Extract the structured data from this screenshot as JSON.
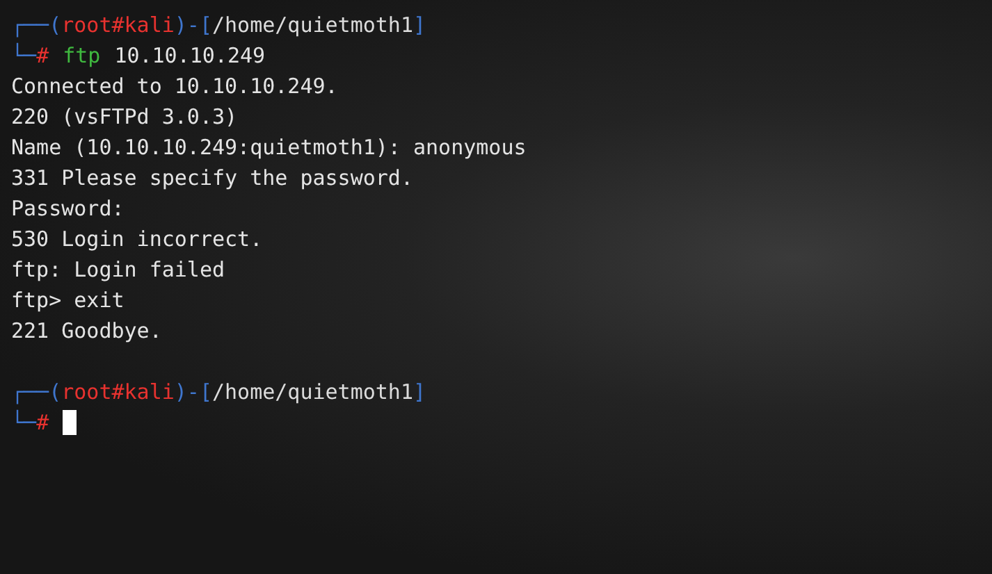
{
  "terminal": {
    "lines": [
      {
        "kind": "prompt",
        "open": "┌──(",
        "user": "root#kali",
        "mid": ")-[",
        "path": "/home/quietmoth1",
        "close": "]",
        "corner": "└─",
        "symbol": "#",
        "command": "ftp",
        "args": "10.10.10.249"
      },
      {
        "kind": "output",
        "text": "Connected to 10.10.10.249."
      },
      {
        "kind": "output",
        "text": "220 (vsFTPd 3.0.3)"
      },
      {
        "kind": "output",
        "text": "Name (10.10.10.249:quietmoth1): anonymous"
      },
      {
        "kind": "output",
        "text": "331 Please specify the password."
      },
      {
        "kind": "output",
        "text": "Password:"
      },
      {
        "kind": "output",
        "text": "530 Login incorrect."
      },
      {
        "kind": "output",
        "text": "ftp: Login failed"
      },
      {
        "kind": "output",
        "text": "ftp> exit"
      },
      {
        "kind": "output",
        "text": "221 Goodbye."
      },
      {
        "kind": "blank"
      },
      {
        "kind": "prompt",
        "open": "┌──(",
        "user": "root#kali",
        "mid": ")-[",
        "path": "/home/quietmoth1",
        "close": "]",
        "corner": "└─",
        "symbol": "#",
        "cursor": true
      }
    ]
  }
}
